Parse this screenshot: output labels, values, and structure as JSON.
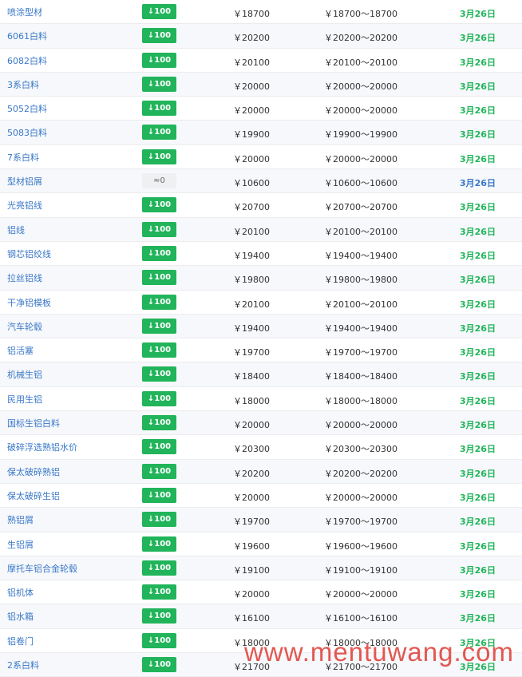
{
  "table": {
    "rows": [
      {
        "name": "喷涂型材",
        "change": "↓100",
        "price": "￥18700",
        "range": "￥18700～18700",
        "date": "3月26日",
        "trend": "down"
      },
      {
        "name": "6061白料",
        "change": "↓100",
        "price": "￥20200",
        "range": "￥20200～20200",
        "date": "3月26日",
        "trend": "down"
      },
      {
        "name": "6082白料",
        "change": "↓100",
        "price": "￥20100",
        "range": "￥20100～20100",
        "date": "3月26日",
        "trend": "down"
      },
      {
        "name": "3系白料",
        "change": "↓100",
        "price": "￥20000",
        "range": "￥20000～20000",
        "date": "3月26日",
        "trend": "down"
      },
      {
        "name": "5052白料",
        "change": "↓100",
        "price": "￥20000",
        "range": "￥20000～20000",
        "date": "3月26日",
        "trend": "down"
      },
      {
        "name": "5083白料",
        "change": "↓100",
        "price": "￥19900",
        "range": "￥19900～19900",
        "date": "3月26日",
        "trend": "down"
      },
      {
        "name": "7系白料",
        "change": "↓100",
        "price": "￥20000",
        "range": "￥20000～20000",
        "date": "3月26日",
        "trend": "down"
      },
      {
        "name": "型材铝屑",
        "change": "≈0",
        "price": "￥10600",
        "range": "￥10600～10600",
        "date": "3月26日",
        "trend": "flat"
      },
      {
        "name": "光亮铝线",
        "change": "↓100",
        "price": "￥20700",
        "range": "￥20700～20700",
        "date": "3月26日",
        "trend": "down"
      },
      {
        "name": "铝线",
        "change": "↓100",
        "price": "￥20100",
        "range": "￥20100～20100",
        "date": "3月26日",
        "trend": "down"
      },
      {
        "name": "钢芯铝绞线",
        "change": "↓100",
        "price": "￥19400",
        "range": "￥19400～19400",
        "date": "3月26日",
        "trend": "down"
      },
      {
        "name": "拉丝铝线",
        "change": "↓100",
        "price": "￥19800",
        "range": "￥19800～19800",
        "date": "3月26日",
        "trend": "down"
      },
      {
        "name": "干净铝模板",
        "change": "↓100",
        "price": "￥20100",
        "range": "￥20100～20100",
        "date": "3月26日",
        "trend": "down"
      },
      {
        "name": "汽车轮毂",
        "change": "↓100",
        "price": "￥19400",
        "range": "￥19400～19400",
        "date": "3月26日",
        "trend": "down"
      },
      {
        "name": "铝活塞",
        "change": "↓100",
        "price": "￥19700",
        "range": "￥19700～19700",
        "date": "3月26日",
        "trend": "down"
      },
      {
        "name": "机械生铝",
        "change": "↓100",
        "price": "￥18400",
        "range": "￥18400～18400",
        "date": "3月26日",
        "trend": "down"
      },
      {
        "name": "民用生铝",
        "change": "↓100",
        "price": "￥18000",
        "range": "￥18000～18000",
        "date": "3月26日",
        "trend": "down"
      },
      {
        "name": "国标生铝白料",
        "change": "↓100",
        "price": "￥20000",
        "range": "￥20000～20000",
        "date": "3月26日",
        "trend": "down"
      },
      {
        "name": "破碎浮选熟铝水价",
        "change": "↓100",
        "price": "￥20300",
        "range": "￥20300～20300",
        "date": "3月26日",
        "trend": "down"
      },
      {
        "name": "保太破碎熟铝",
        "change": "↓100",
        "price": "￥20200",
        "range": "￥20200～20200",
        "date": "3月26日",
        "trend": "down"
      },
      {
        "name": "保太破碎生铝",
        "change": "↓100",
        "price": "￥20000",
        "range": "￥20000～20000",
        "date": "3月26日",
        "trend": "down"
      },
      {
        "name": "熟铝屑",
        "change": "↓100",
        "price": "￥19700",
        "range": "￥19700～19700",
        "date": "3月26日",
        "trend": "down"
      },
      {
        "name": "生铝屑",
        "change": "↓100",
        "price": "￥19600",
        "range": "￥19600～19600",
        "date": "3月26日",
        "trend": "down"
      },
      {
        "name": "摩托车铝合金轮毂",
        "change": "↓100",
        "price": "￥19100",
        "range": "￥19100～19100",
        "date": "3月26日",
        "trend": "down"
      },
      {
        "name": "铝机体",
        "change": "↓100",
        "price": "￥20000",
        "range": "￥20000～20000",
        "date": "3月26日",
        "trend": "down"
      },
      {
        "name": "铝水箱",
        "change": "↓100",
        "price": "￥16100",
        "range": "￥16100～16100",
        "date": "3月26日",
        "trend": "down"
      },
      {
        "name": "铝卷门",
        "change": "↓100",
        "price": "￥18000",
        "range": "￥18000～18000",
        "date": "3月26日",
        "trend": "down"
      },
      {
        "name": "2系白料",
        "change": "↓100",
        "price": "￥21700",
        "range": "￥21700～21700",
        "date": "3月26日",
        "trend": "down"
      }
    ]
  },
  "watermark": {
    "text": "www.mentuwang.com"
  },
  "colors": {
    "link": "#3a78c8",
    "down_badge": "#21b45a",
    "flat_badge": "#eef0f2",
    "date_green": "#21b45a",
    "watermark": "#e0463f"
  }
}
